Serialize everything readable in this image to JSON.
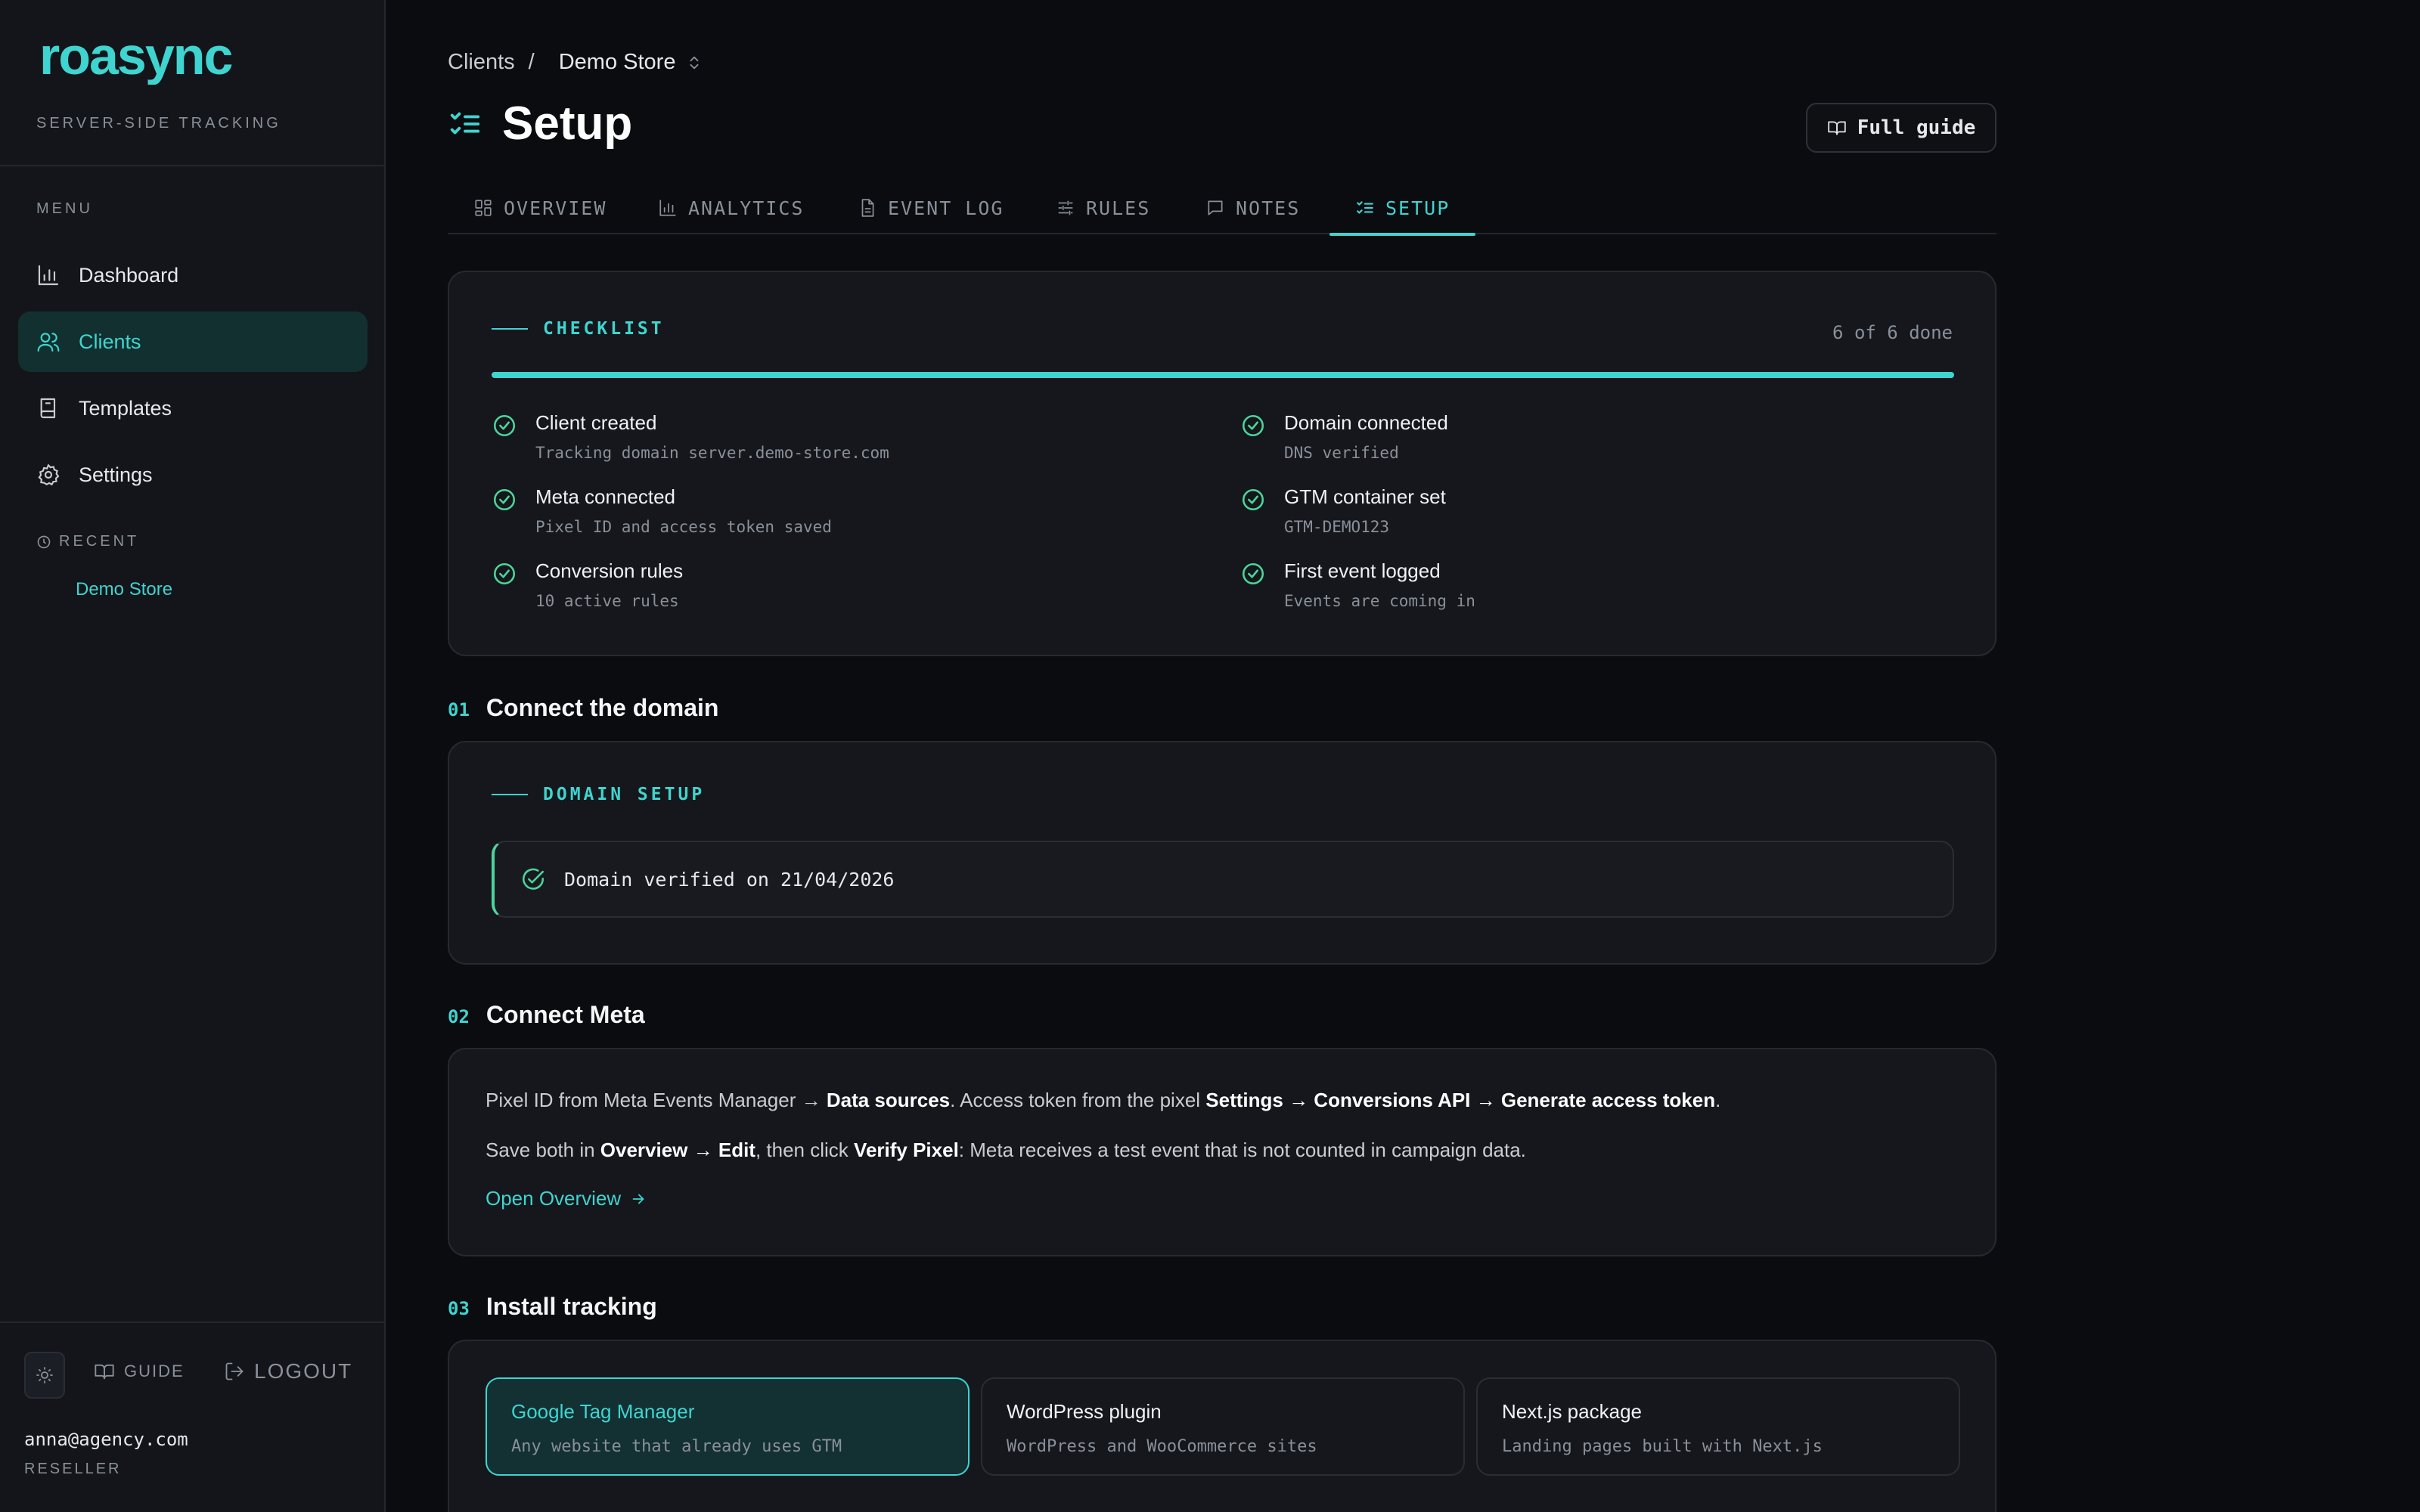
{
  "sidebar": {
    "logo_text": "roasync",
    "tagline": "SERVER-SIDE TRACKING",
    "menu_label": "MENU",
    "items": [
      {
        "label": "Dashboard",
        "icon": "bar-chart-icon"
      },
      {
        "label": "Clients",
        "icon": "users-icon",
        "active": true
      },
      {
        "label": "Templates",
        "icon": "book-icon"
      },
      {
        "label": "Settings",
        "icon": "gear-icon"
      }
    ],
    "recent_label": "RECENT",
    "recent_items": [
      "Demo Store"
    ],
    "guide_label": "GUIDE",
    "logout_label": "LOGOUT",
    "user_email": "anna@agency.com",
    "user_role": "RESELLER"
  },
  "breadcrumb": {
    "parent": "Clients",
    "separator": "/",
    "current": "Demo Store"
  },
  "header": {
    "title": "Setup",
    "guide_button": "Full guide"
  },
  "tabs": [
    {
      "label": "OVERVIEW",
      "icon": "grid-icon"
    },
    {
      "label": "ANALYTICS",
      "icon": "bar-chart-icon"
    },
    {
      "label": "EVENT LOG",
      "icon": "file-icon"
    },
    {
      "label": "RULES",
      "icon": "sliders-icon"
    },
    {
      "label": "NOTES",
      "icon": "message-icon"
    },
    {
      "label": "SETUP",
      "icon": "list-checks-icon",
      "active": true
    }
  ],
  "checklist": {
    "title": "CHECKLIST",
    "count": "6 of 6 done",
    "progress": 1.0,
    "items": [
      {
        "title": "Client created",
        "sub": "Tracking domain server.demo-store.com"
      },
      {
        "title": "Domain connected",
        "sub": "DNS verified"
      },
      {
        "title": "Meta connected",
        "sub": "Pixel ID and access token saved"
      },
      {
        "title": "GTM container set",
        "sub": "GTM-DEMO123"
      },
      {
        "title": "Conversion rules",
        "sub": "10 active rules"
      },
      {
        "title": "First event logged",
        "sub": "Events are coming in"
      }
    ]
  },
  "steps": {
    "domain": {
      "num": "01",
      "title": "Connect the domain",
      "card_title": "DOMAIN SETUP",
      "status": "Domain verified on 21/04/2026"
    },
    "meta": {
      "num": "02",
      "title": "Connect Meta",
      "p1": {
        "a": "Pixel ID from Meta Events Manager → ",
        "b": "Data sources",
        "c": ". Access token from the pixel ",
        "d": "Settings → Conversions API → Generate access token",
        "e": "."
      },
      "p2": {
        "a": "Save both in ",
        "b": "Overview → Edit",
        "c": ", then click ",
        "d": "Verify Pixel",
        "e": ": Meta receives a test event that is not counted in campaign data."
      },
      "link": "Open Overview"
    },
    "install": {
      "num": "03",
      "title": "Install tracking",
      "options": [
        {
          "title": "Google Tag Manager",
          "sub": "Any website that already uses GTM",
          "active": true
        },
        {
          "title": "WordPress plugin",
          "sub": "WordPress and WooCommerce sites"
        },
        {
          "title": "Next.js package",
          "sub": "Landing pages built with Next.js"
        }
      ]
    }
  },
  "colors": {
    "accent": "#3fd4cf",
    "success": "#4cd59a",
    "background": "#0b0c10",
    "surface": "#15171c"
  }
}
